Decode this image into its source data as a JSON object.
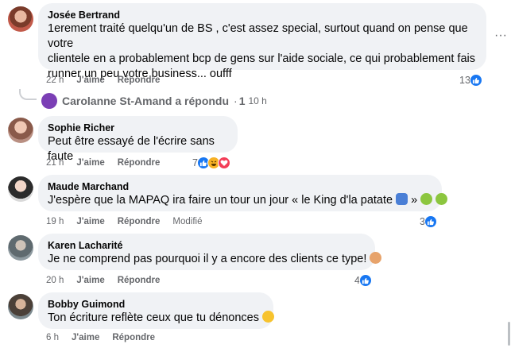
{
  "comments": [
    {
      "author": "Josée Bertrand",
      "lines": [
        "1erement traité quelqu'un de BS , c'est assez special, surtout quand on pense que votre",
        "clientele en a probablement bcp de gens sur l'aide sociale, ce qui probablement fais",
        "runner un peu votre business... oufff"
      ],
      "time": "22 h",
      "like": "J'aime",
      "reply": "Répondre",
      "reaction_count": "13"
    },
    {
      "author": "Sophie Richer",
      "lines": [
        "Peut être essayé de l'écrire sans faute"
      ],
      "time": "21 h",
      "like": "J'aime",
      "reply": "Répondre",
      "reaction_count": "7"
    },
    {
      "author": "Maude Marchand",
      "lines": [
        "J'espère que la MAPAQ ira faire un tour un jour « le King d'la patate",
        "»"
      ],
      "time": "19 h",
      "like": "J'aime",
      "reply": "Répondre",
      "modified": "Modifié",
      "reaction_count": "3"
    },
    {
      "author": "Karen Lacharité",
      "lines": [
        "Je ne comprend pas pourquoi il y a encore des clients ce type!"
      ],
      "time": "20 h",
      "like": "J'aime",
      "reply": "Répondre",
      "reaction_count": "4"
    },
    {
      "author": "Bobby Guimond",
      "lines": [
        "Ton écriture reflète ceux que tu dénonces"
      ],
      "time": "6 h",
      "like": "J'aime",
      "reply": "Répondre"
    }
  ],
  "reply_summary": {
    "name": "Carolanne St-Amand a répondu",
    "separator": "·",
    "count": "1",
    "time": "10 h"
  },
  "icons": {
    "more": "more-dots-icon",
    "like": "like-icon",
    "haha": "haha-icon",
    "love": "love-icon"
  },
  "colors": {
    "bubble": "#f0f2f5",
    "like_blue": "#1877f2",
    "meta_grey": "#65676b"
  }
}
